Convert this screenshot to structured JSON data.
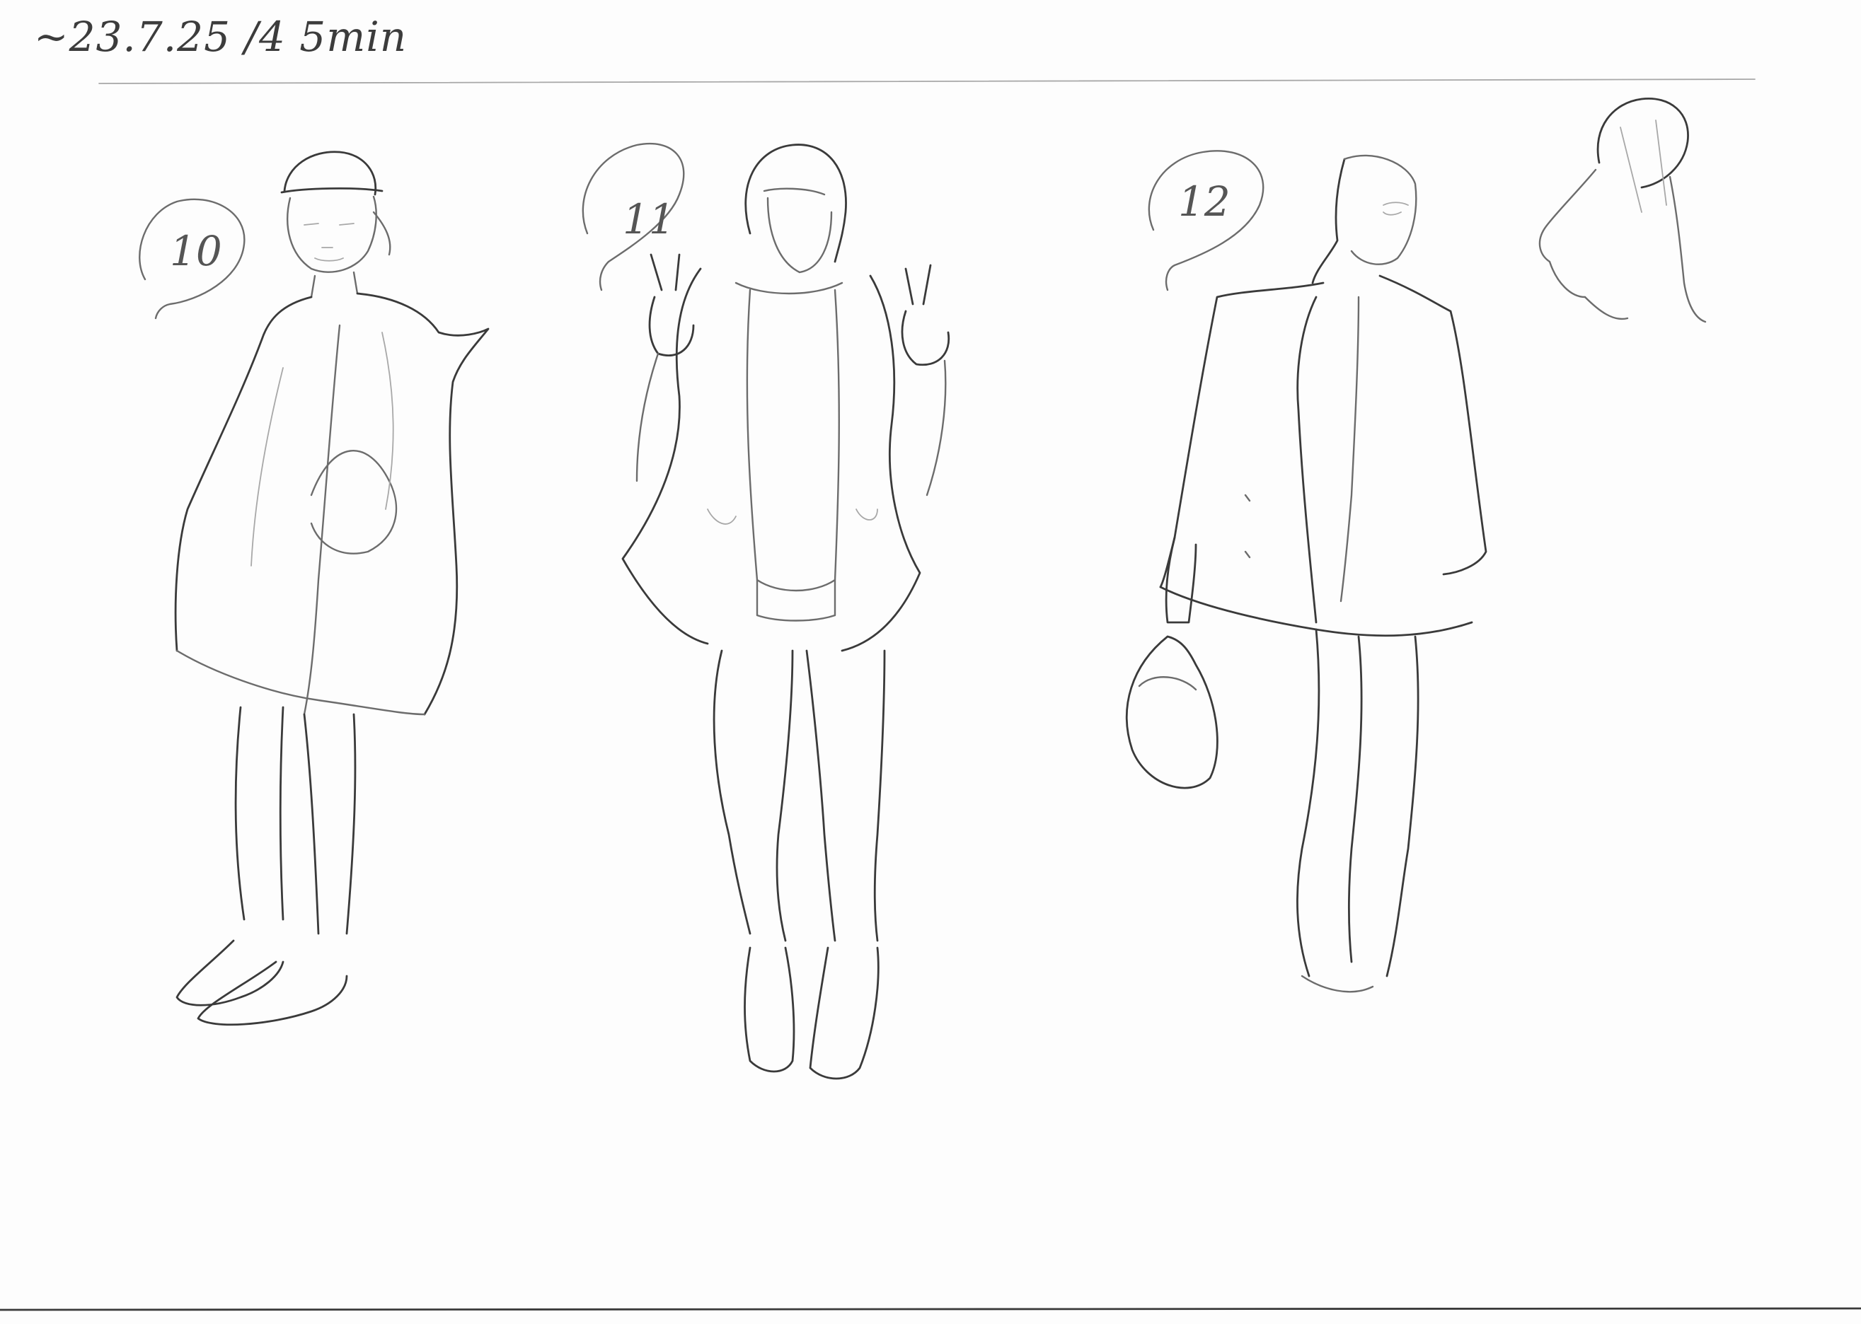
{
  "sheet": {
    "header_note": "~23.7.25 /4 5min"
  },
  "figures": [
    {
      "number_label": "10"
    },
    {
      "number_label": "11"
    },
    {
      "number_label": "12"
    }
  ],
  "icons": [
    "pencil-figure-sketch",
    "hair-study-sketch"
  ]
}
